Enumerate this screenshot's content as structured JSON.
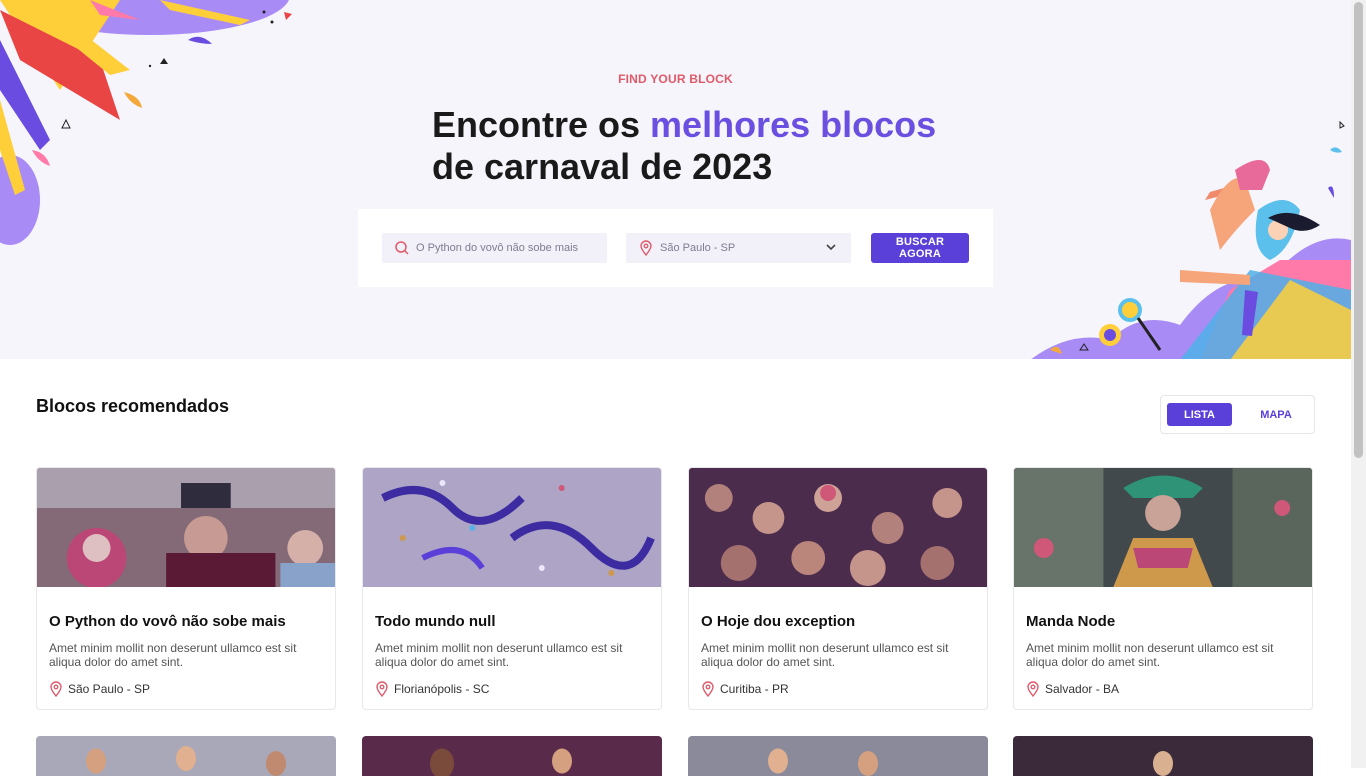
{
  "hero": {
    "eyebrow": "FIND YOUR BLOCK",
    "title_part1": "Encontre os ",
    "title_accent": "melhores blocos",
    "title_line2": "de carnaval de 2023"
  },
  "search": {
    "query_placeholder": "O Python do vovô não sobe mais",
    "city_value": "São Paulo - SP",
    "button_label": "BUSCAR AGORA"
  },
  "recommended": {
    "title": "Blocos recomendados",
    "view_toggle": {
      "list_label": "LISTA",
      "map_label": "MAPA",
      "active": "LISTA"
    }
  },
  "cards": [
    {
      "title": "O Python do vovô não sobe mais",
      "description": "Amet minim mollit non deserunt ullamco est sit aliqua dolor do amet sint.",
      "location": "São Paulo - SP"
    },
    {
      "title": "Todo mundo null",
      "description": "Amet minim mollit non deserunt ullamco est sit aliqua dolor do amet sint.",
      "location": "Florianópolis - SC"
    },
    {
      "title": "O Hoje dou exception",
      "description": "Amet minim mollit non deserunt ullamco est sit aliqua dolor do amet sint.",
      "location": "Curitiba - PR"
    },
    {
      "title": "Manda Node",
      "description": "Amet minim mollit non deserunt ullamco est sit aliqua dolor do amet sint.",
      "location": "Salvador - BA"
    }
  ],
  "colors": {
    "accent": "#5b3fd9",
    "accent_text": "#6b4fe0",
    "eyebrow": "#e05a6a",
    "hero_bg": "#f6f5fb"
  },
  "icons": {
    "search": "search-icon",
    "location": "location-pin-icon",
    "chevron": "chevron-down-icon"
  }
}
